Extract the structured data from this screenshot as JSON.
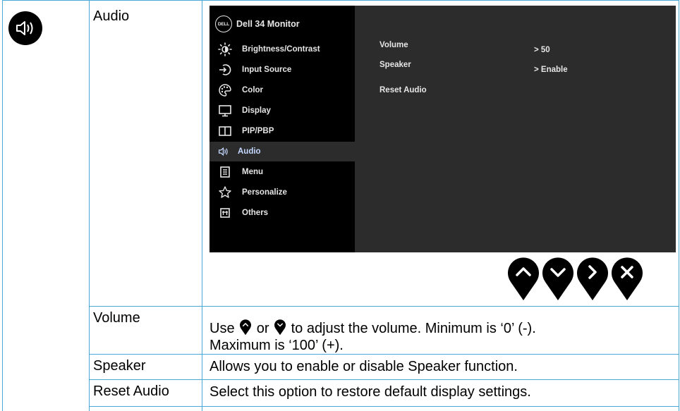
{
  "section": {
    "icon": "speaker-icon",
    "title": "Audio"
  },
  "osd": {
    "brand": "Dell 34 Monitor",
    "logo_text": "DELL",
    "menu": [
      {
        "label": "Brightness/Contrast",
        "icon": "brightness-icon"
      },
      {
        "label": "Input Source",
        "icon": "input-source-icon"
      },
      {
        "label": "Color",
        "icon": "color-palette-icon"
      },
      {
        "label": "Display",
        "icon": "display-icon"
      },
      {
        "label": "PIP/PBP",
        "icon": "pip-icon"
      },
      {
        "label": "Audio",
        "icon": "speaker-icon",
        "active": true
      },
      {
        "label": "Menu",
        "icon": "menu-icon"
      },
      {
        "label": "Personalize",
        "icon": "star-icon"
      },
      {
        "label": "Others",
        "icon": "others-icon"
      }
    ],
    "options": [
      {
        "label": "Volume",
        "value": "> 50"
      },
      {
        "label": "Speaker",
        "value": "> Enable"
      },
      {
        "label": "Reset Audio",
        "value": ""
      }
    ]
  },
  "nav_buttons": [
    "up-arrow-icon",
    "down-arrow-icon",
    "right-arrow-icon",
    "close-icon"
  ],
  "rows": [
    {
      "label": "Volume",
      "desc_prefix": "Use",
      "desc_mid": "or",
      "desc_suffix": "to adjust the volume. Minimum is ‘0’ (-).",
      "desc_line2": "Maximum is ‘100’ (+)."
    },
    {
      "label": "Speaker",
      "desc": "Allows you to enable or disable Speaker function."
    },
    {
      "label": "Reset Audio",
      "desc": "Select this option to restore default display settings."
    }
  ],
  "colors": {
    "grid": "#4aa8d8",
    "osd_bg": "#2c2c2c",
    "osd_menu_bg": "#000000",
    "osd_text": "#e6e6e6",
    "osd_active_text": "#c5d8ff"
  }
}
